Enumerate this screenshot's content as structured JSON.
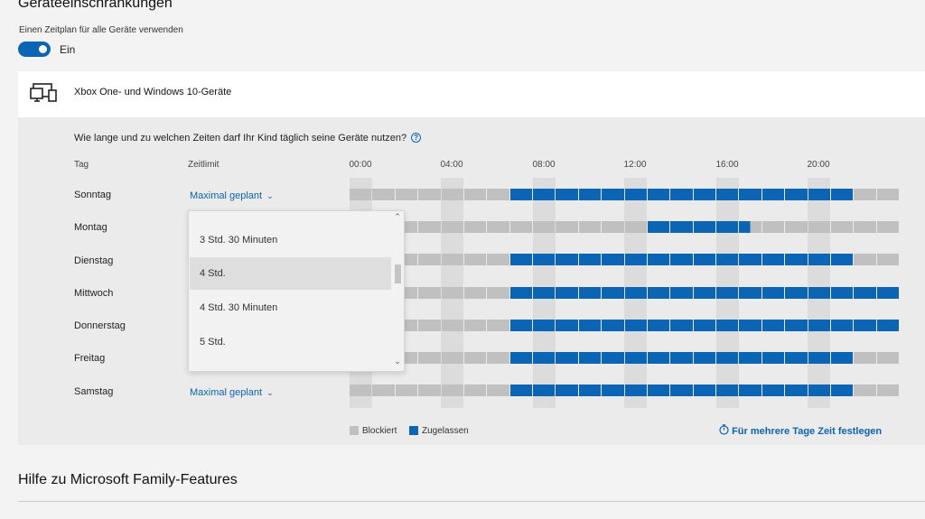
{
  "header": {
    "title": "Geräteeinschränkungen",
    "schedule_label": "Einen Zeitplan für alle Geräte verwenden",
    "toggle_state": "Ein"
  },
  "device": {
    "icon": "devices-icon",
    "title": "Xbox One- und Windows 10-Geräte"
  },
  "schedule": {
    "question": "Wie lange und zu welchen Zeiten darf Ihr Kind täglich seine Geräte nutzen?",
    "help_icon": "?",
    "col_day": "Tag",
    "col_limit": "Zeitlimit",
    "hours": [
      "00:00",
      "04:00",
      "08:00",
      "12:00",
      "16:00",
      "20:00"
    ],
    "days": [
      {
        "name": "Sonntag",
        "limit": "Maximal geplant",
        "allowed": [
          [
            7,
            22
          ]
        ]
      },
      {
        "name": "Montag",
        "limit": "",
        "allowed": [
          [
            13,
            17.5
          ]
        ]
      },
      {
        "name": "Dienstag",
        "limit": "",
        "allowed": [
          [
            7,
            22
          ]
        ]
      },
      {
        "name": "Mittwoch",
        "limit": "",
        "allowed": [
          [
            7,
            24
          ]
        ]
      },
      {
        "name": "Donnerstag",
        "limit": "",
        "allowed": [
          [
            7,
            24
          ]
        ]
      },
      {
        "name": "Freitag",
        "limit": "",
        "allowed": [
          [
            7,
            22
          ]
        ]
      },
      {
        "name": "Samstag",
        "limit": "Maximal geplant",
        "allowed": [
          [
            7,
            22
          ]
        ]
      }
    ],
    "dropdown": {
      "options": [
        "3 Std. 30 Minuten",
        "4 Std.",
        "4 Std. 30 Minuten",
        "5 Std."
      ],
      "highlighted": "4 Std."
    },
    "legend": {
      "blocked": "Blockiert",
      "allowed": "Zugelassen"
    },
    "multi_day_link": "Für mehrere Tage Zeit festlegen"
  },
  "colors": {
    "allowed": "#0b64b4",
    "blocked": "#c0c0c0",
    "accent": "#0b64b4"
  },
  "footer": {
    "help_title": "Hilfe zu Microsoft Family-Features"
  }
}
